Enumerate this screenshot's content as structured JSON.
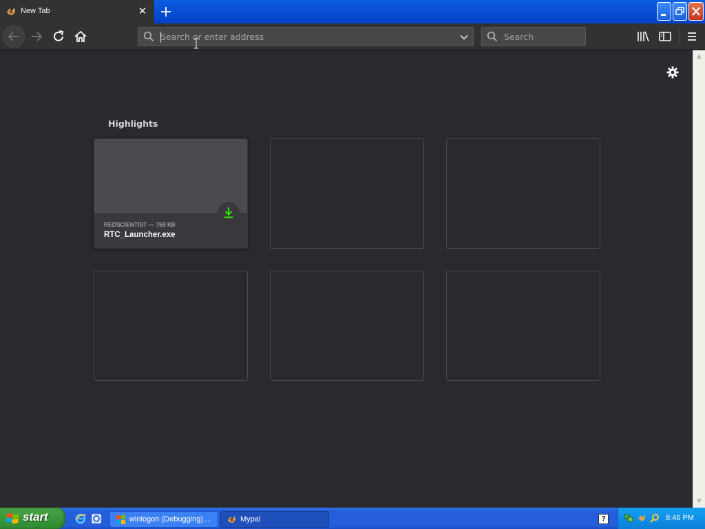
{
  "browser": {
    "tab": {
      "title": "New Tab"
    },
    "urlbar": {
      "placeholder": "Search or enter address"
    },
    "searchbar": {
      "placeholder": "Search"
    }
  },
  "newtab": {
    "highlights_title": "Highlights",
    "cards": [
      {
        "meta": "REDSCIENTIST — 759 KB",
        "filename": "RTC_Launcher.exe",
        "type": "download"
      },
      {
        "meta": "",
        "filename": "",
        "type": "empty"
      },
      {
        "meta": "",
        "filename": "",
        "type": "empty"
      },
      {
        "meta": "",
        "filename": "",
        "type": "empty"
      },
      {
        "meta": "",
        "filename": "",
        "type": "empty"
      },
      {
        "meta": "",
        "filename": "",
        "type": "empty"
      }
    ]
  },
  "taskbar": {
    "start_label": "start",
    "tasks": [
      {
        "label": "winlogon (Debugging)...",
        "state": "inactive"
      },
      {
        "label": "Mypal",
        "state": "active"
      }
    ],
    "clock": "8:46 PM"
  },
  "colors": {
    "content_bg": "#2a2a2e",
    "download_green": "#30e60b",
    "xp_blue": "#245edb",
    "start_green": "#3c9a3c"
  },
  "icons": [
    "back-arrow-icon",
    "forward-arrow-icon",
    "reload-icon",
    "home-icon",
    "search-icon",
    "dropdown-chevron-icon",
    "library-icon",
    "sidebar-icon",
    "menu-hamburger-icon",
    "gear-icon",
    "download-arrow-icon"
  ]
}
